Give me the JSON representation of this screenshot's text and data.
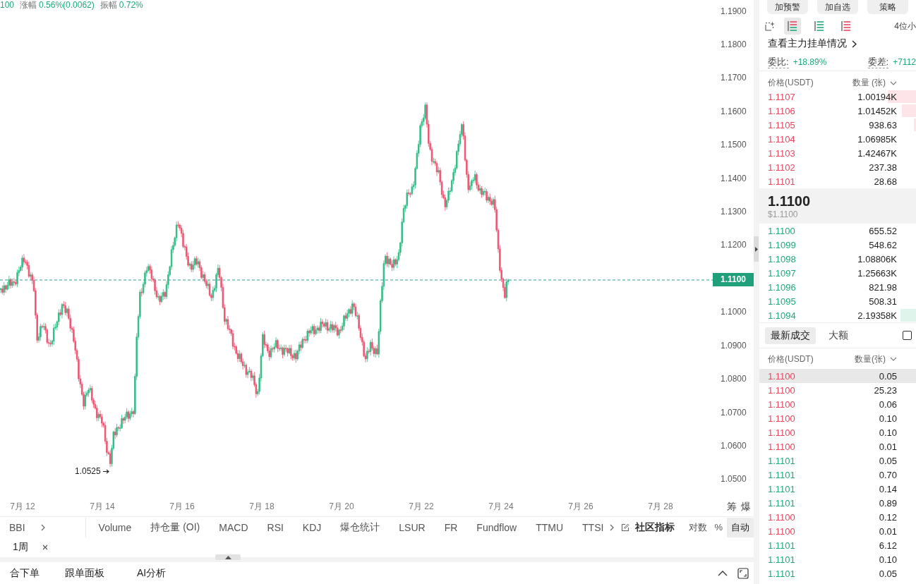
{
  "chart_header": {
    "last_price": "100",
    "stats": [
      {
        "label": "涨幅",
        "value": "0.56%(0.0062)"
      },
      {
        "label": "振幅",
        "value": "0.72%"
      }
    ]
  },
  "chart": {
    "price_axis": {
      "upper": [
        "1.1900",
        "1.1800",
        "1.1700",
        "1.1600",
        "1.1500",
        "1.1400",
        "1.1300",
        "1.1200"
      ],
      "current_price_tag": "1.1100",
      "lower": [
        "1.1000",
        "1.0900",
        "1.0800",
        "1.0700",
        "1.0600",
        "1.0500"
      ]
    },
    "low_marker": "1.0525",
    "date_axis": [
      "7月 12",
      "7月 14",
      "7月 16",
      "7月 18",
      "7月 20",
      "7月 22",
      "7月 24",
      "7月 26",
      "7月 28"
    ],
    "side_buttons": [
      "筹",
      "爆"
    ]
  },
  "indicator_bar": {
    "pinned": "BBI",
    "indicators": [
      "Volume",
      "持仓量 (OI)",
      "MACD",
      "RSI",
      "KDJ",
      "爆仓统计",
      "LSUR",
      "FR",
      "Fundflow",
      "TTMU",
      "TTSI"
    ],
    "community": "社区指标",
    "scale_options": [
      {
        "label": "对数",
        "selected": false
      },
      {
        "label": "%",
        "selected": false
      },
      {
        "label": "自动",
        "selected": true
      }
    ]
  },
  "interval_tags": [
    {
      "label": "1周"
    }
  ],
  "bottom_tabs": [
    "合下单",
    "跟单面板",
    "AI分析"
  ],
  "side_panel": {
    "action_buttons": [
      "加预警",
      "加自选",
      "策略"
    ],
    "view_modes": [
      {
        "kind": "both",
        "selected": true
      },
      {
        "kind": "bids",
        "selected": false
      },
      {
        "kind": "asks",
        "selected": false
      }
    ],
    "precision": "4位小",
    "big_orders_link": "查看主力挂单情况",
    "ratio": {
      "label": "委比:",
      "value": "+18.89%"
    },
    "difference": {
      "label": "委差:",
      "value": "+7112"
    },
    "book_header": {
      "price": "价格(USDT)",
      "amount": "数量 (张)"
    },
    "asks": [
      {
        "price": "1.1107",
        "amount": "1.00194K",
        "level": 0.18
      },
      {
        "price": "1.1106",
        "amount": "1.01452K",
        "level": 0.09
      },
      {
        "price": "1.1105",
        "amount": "938.63",
        "level": 0.015
      },
      {
        "price": "1.1104",
        "amount": "1.06985K"
      },
      {
        "price": "1.1103",
        "amount": "1.42467K"
      },
      {
        "price": "1.1102",
        "amount": "237.38"
      },
      {
        "price": "1.1101",
        "amount": "28.68"
      }
    ],
    "mid": {
      "price": "1.1100",
      "usd": "$1.1100"
    },
    "bids": [
      {
        "price": "1.1100",
        "amount": "655.52"
      },
      {
        "price": "1.1099",
        "amount": "548.62"
      },
      {
        "price": "1.1098",
        "amount": "1.08806K"
      },
      {
        "price": "1.1097",
        "amount": "1.25663K"
      },
      {
        "price": "1.1096",
        "amount": "821.98"
      },
      {
        "price": "1.1095",
        "amount": "508.31"
      },
      {
        "price": "1.1094",
        "amount": "2.19358K",
        "level": 0.1
      }
    ],
    "trade_tabs": [
      {
        "label": "最新成交",
        "selected": true
      },
      {
        "label": "大额",
        "selected": false
      }
    ],
    "trade_filter_checked": false,
    "trades_header": {
      "price": "价格(USDT)",
      "amount": "数量(张)"
    },
    "trades": [
      {
        "price": "1.1100",
        "amount": "0.05",
        "color": "#e5475f",
        "highlighted": true
      },
      {
        "price": "1.1100",
        "amount": "25.23",
        "color": "#e5475f",
        "highlighted": false
      },
      {
        "price": "1.1100",
        "amount": "0.06",
        "color": "#e5475f",
        "highlighted": false
      },
      {
        "price": "1.1100",
        "amount": "0.10",
        "color": "#e5475f",
        "highlighted": false
      },
      {
        "price": "1.1100",
        "amount": "0.10",
        "color": "#e5475f",
        "highlighted": false
      },
      {
        "price": "1.1100",
        "amount": "0.01",
        "color": "#e5475f",
        "highlighted": false
      },
      {
        "price": "1.1101",
        "amount": "0.05",
        "color": "#20a978",
        "highlighted": false
      },
      {
        "price": "1.1101",
        "amount": "0.70",
        "color": "#20a978",
        "highlighted": false
      },
      {
        "price": "1.1101",
        "amount": "0.14",
        "color": "#20a978",
        "highlighted": false
      },
      {
        "price": "1.1101",
        "amount": "0.89",
        "color": "#20a978",
        "highlighted": false
      },
      {
        "price": "1.1100",
        "amount": "0.12",
        "color": "#e5475f",
        "highlighted": false
      },
      {
        "price": "1.1100",
        "amount": "0.01",
        "color": "#e5475f",
        "highlighted": false
      },
      {
        "price": "1.1101",
        "amount": "6.12",
        "color": "#20a978",
        "highlighted": false
      },
      {
        "price": "1.1101",
        "amount": "0.10",
        "color": "#20a978",
        "highlighted": false
      },
      {
        "price": "1.1101",
        "amount": "0.05",
        "color": "#20a978",
        "highlighted": false
      }
    ]
  }
}
